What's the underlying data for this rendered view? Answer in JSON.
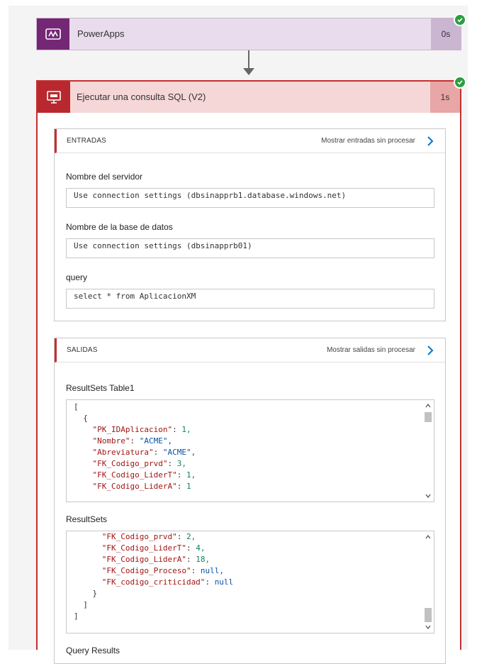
{
  "powerapps_step": {
    "title": "PowerApps",
    "duration": "0s"
  },
  "sql_step": {
    "title": "Ejecutar una consulta SQL (V2)",
    "duration": "1s"
  },
  "inputs": {
    "title": "ENTRADAS",
    "raw_link": "Mostrar entradas sin procesar",
    "server_label": "Nombre del servidor",
    "server_value": "Use connection settings (dbsinapprb1.database.windows.net)",
    "database_label": "Nombre de la base de datos",
    "database_value": "Use connection settings (dbsinapprb01)",
    "query_label": "query",
    "query_value": "select * from AplicacionXM"
  },
  "outputs": {
    "title": "SALIDAS",
    "raw_link": "Mostrar salidas sin procesar",
    "table1_label": "ResultSets Table1",
    "table1_lines": [
      {
        "key": "",
        "sep": "[",
        "value": "",
        "vtype": "p"
      },
      {
        "key": "",
        "sep": "  {",
        "value": "",
        "vtype": "p"
      },
      {
        "key": "    \"PK_IDAplicacion\"",
        "sep": ": ",
        "value": "1,",
        "vtype": "n"
      },
      {
        "key": "    \"Nombre\"",
        "sep": ": ",
        "value": "\"ACME\",",
        "vtype": "s"
      },
      {
        "key": "    \"Abreviatura\"",
        "sep": ": ",
        "value": "\"ACME\",",
        "vtype": "s"
      },
      {
        "key": "    \"FK_Codigo_prvd\"",
        "sep": ": ",
        "value": "3,",
        "vtype": "n"
      },
      {
        "key": "    \"FK_Codigo_LiderT\"",
        "sep": ": ",
        "value": "1,",
        "vtype": "n"
      },
      {
        "key": "    \"FK_Codigo_LiderA\"",
        "sep": ": ",
        "value": "1",
        "vtype": "n"
      }
    ],
    "resultsets_label": "ResultSets",
    "resultsets_lines": [
      {
        "key": "      \"FK_Codigo_prvd\"",
        "sep": ": ",
        "value": "2,",
        "vtype": "n"
      },
      {
        "key": "      \"FK_Codigo_LiderT\"",
        "sep": ": ",
        "value": "4,",
        "vtype": "n"
      },
      {
        "key": "      \"FK_Codigo_LiderA\"",
        "sep": ": ",
        "value": "18,",
        "vtype": "n"
      },
      {
        "key": "      \"FK_Codigo_Proceso\"",
        "sep": ": ",
        "value": "null,",
        "vtype": "s"
      },
      {
        "key": "      \"FK_codigo_criticidad\"",
        "sep": ": ",
        "value": "null",
        "vtype": "s"
      },
      {
        "key": "",
        "sep": "    }",
        "value": "",
        "vtype": "p"
      },
      {
        "key": "",
        "sep": "  ]",
        "value": "",
        "vtype": "p"
      },
      {
        "key": "",
        "sep": "]",
        "value": "",
        "vtype": "p"
      }
    ],
    "query_results_label": "Query Results"
  },
  "colors": {
    "powerapps_brand": "#742774",
    "sql_brand": "#b8282e",
    "success": "#2c9e40",
    "link_chevron": "#0078d4"
  },
  "icons": {
    "powerapps": "powerapps-icon",
    "sql": "sql-server-icon",
    "check": "check-icon",
    "chevron": "chevron-right-icon"
  }
}
